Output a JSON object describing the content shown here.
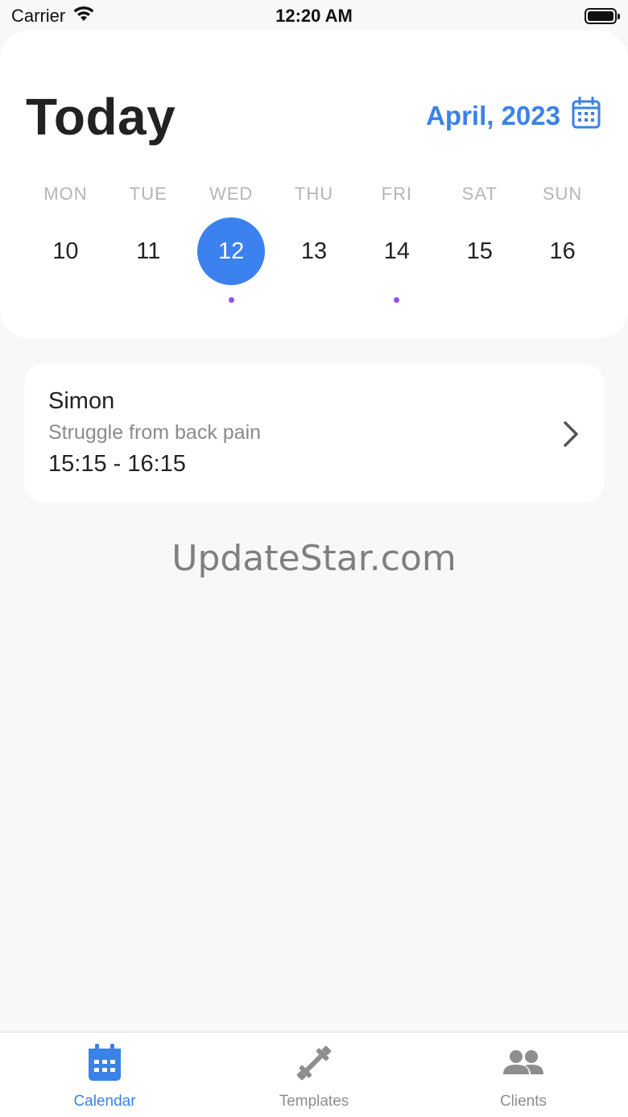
{
  "status_bar": {
    "carrier": "Carrier",
    "time": "12:20 AM"
  },
  "header": {
    "title": "Today",
    "month_label": "April, 2023",
    "accent_color": "#3b82e6",
    "week": [
      {
        "day": "MON",
        "date": "10",
        "selected": false,
        "has_event": false
      },
      {
        "day": "TUE",
        "date": "11",
        "selected": false,
        "has_event": false
      },
      {
        "day": "WED",
        "date": "12",
        "selected": true,
        "has_event": true
      },
      {
        "day": "THU",
        "date": "13",
        "selected": false,
        "has_event": false
      },
      {
        "day": "FRI",
        "date": "14",
        "selected": false,
        "has_event": true
      },
      {
        "day": "SAT",
        "date": "15",
        "selected": false,
        "has_event": false
      },
      {
        "day": "SUN",
        "date": "16",
        "selected": false,
        "has_event": false
      }
    ]
  },
  "appointment": {
    "client": "Simon",
    "note": "Struggle from back pain",
    "time": "15:15 - 16:15"
  },
  "watermark": "UpdateStar.com",
  "tabs": [
    {
      "label": "Calendar",
      "icon": "calendar-icon",
      "active": true
    },
    {
      "label": "Templates",
      "icon": "dumbbell-icon",
      "active": false
    },
    {
      "label": "Clients",
      "icon": "people-icon",
      "active": false
    }
  ]
}
